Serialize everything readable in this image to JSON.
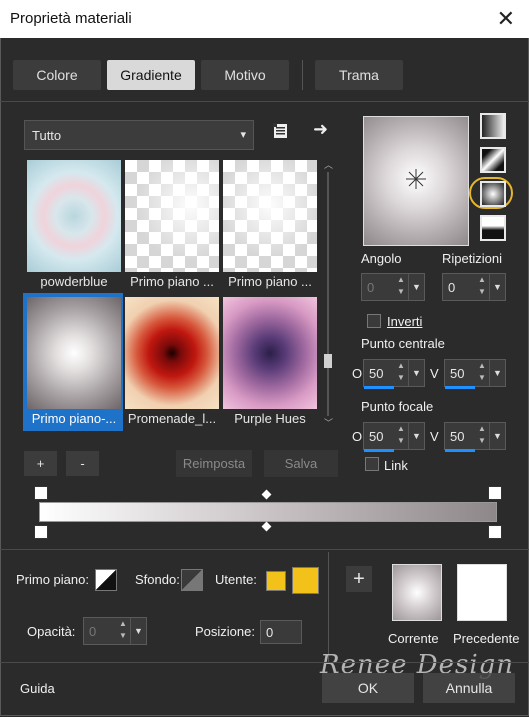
{
  "window": {
    "title": "Proprietà materiali",
    "close": "✕"
  },
  "tabs": [
    {
      "label": "Colore"
    },
    {
      "label": "Gradiente"
    },
    {
      "label": "Motivo"
    },
    {
      "label": "Trama"
    }
  ],
  "category": {
    "value": "Tutto",
    "arrow": "▾"
  },
  "arrow_glyph": "➜",
  "swatches": [
    {
      "label": "powderblue"
    },
    {
      "label": "Primo piano ..."
    },
    {
      "label": "Primo piano ..."
    },
    {
      "label": "Primo piano-..."
    },
    {
      "label": "Promenade_l..."
    },
    {
      "label": "Purple Hues"
    }
  ],
  "buttons": {
    "add": "+",
    "remove": "-",
    "reset": "Reimposta",
    "save": "Salva"
  },
  "properties": {
    "angle_label": "Angolo",
    "angle_value": "0",
    "repeats_label": "Ripetizioni",
    "repeats_value": "0",
    "invert_label": "Inverti",
    "center_label": "Punto centrale",
    "center_o": "50",
    "center_v": "50",
    "focal_label": "Punto focale",
    "focal_o": "50",
    "focal_v": "50",
    "link_label": "Link",
    "o_label": "O",
    "v_label": "V"
  },
  "bottom": {
    "foreground_label": "Primo piano:",
    "background_label": "Sfondo:",
    "user_label": "Utente:",
    "opacity_label": "Opacità:",
    "opacity_value": "0",
    "position_label": "Posizione:",
    "position_value": "0",
    "add_glyph": "+",
    "current_label": "Corrente",
    "previous_label": "Precedente",
    "watermark": "Renee Design"
  },
  "footer": {
    "help": "Guida",
    "ok": "OK",
    "cancel": "Annulla"
  },
  "colors": {
    "user_color": "#f2c21b",
    "accent": "#1e90ff",
    "highlight_ring": "#e5b62a"
  }
}
